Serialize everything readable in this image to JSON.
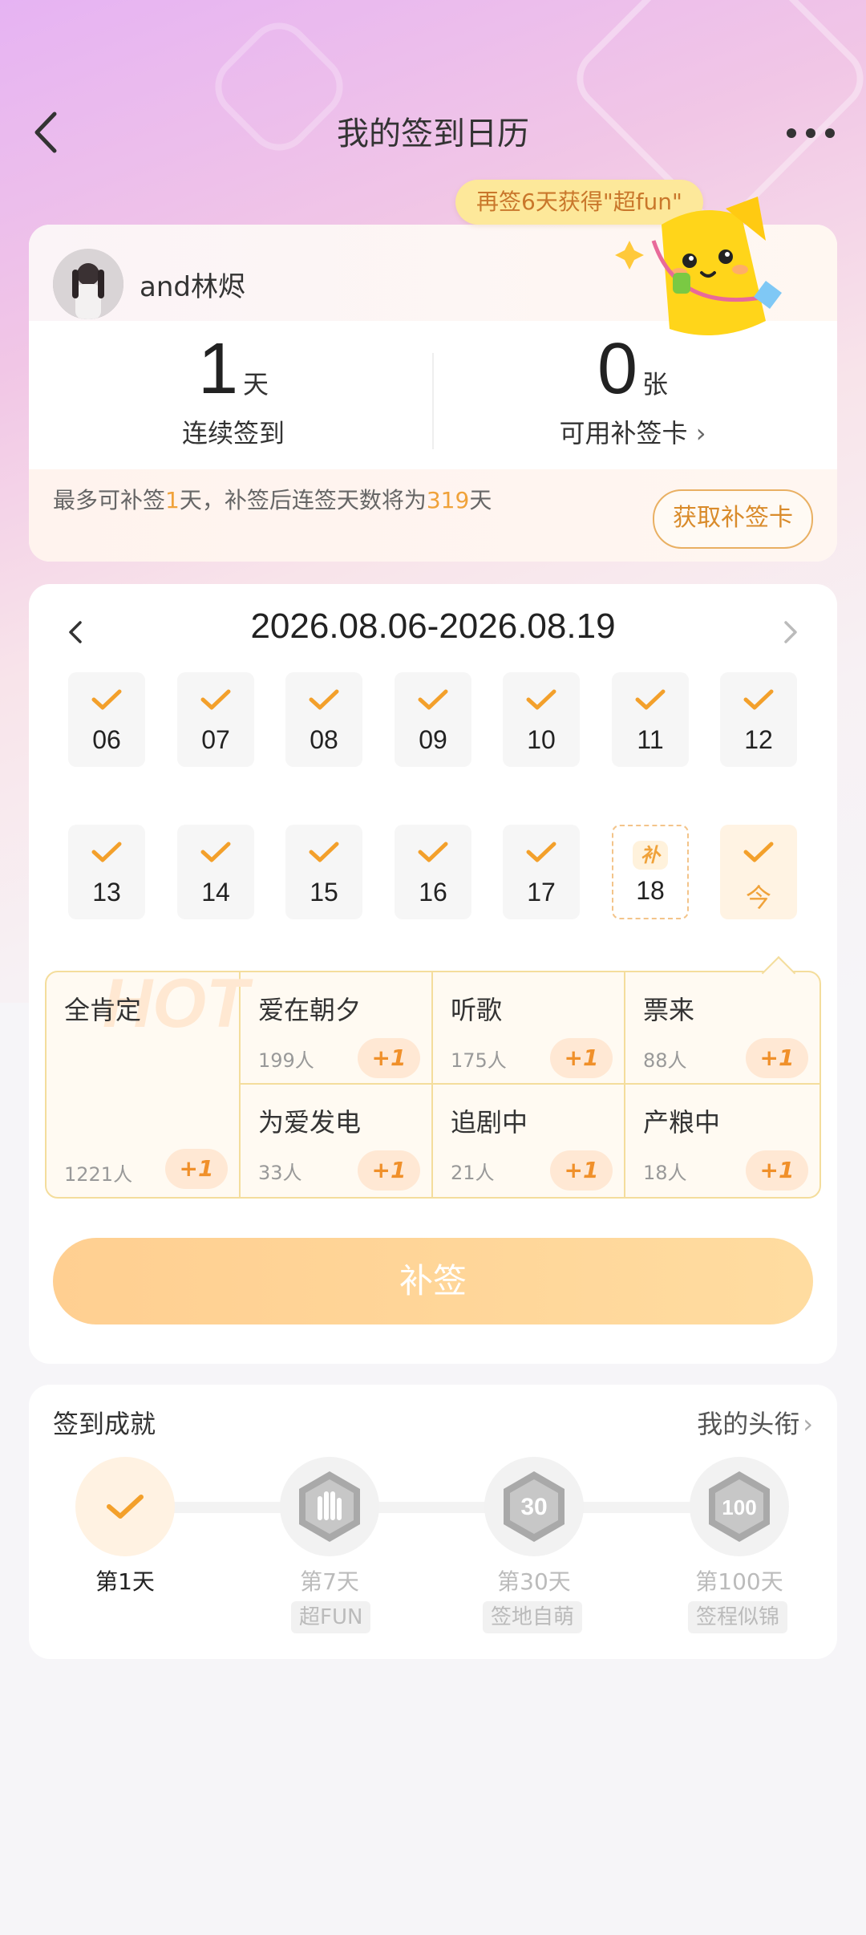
{
  "header": {
    "title": "我的签到日历"
  },
  "promo": {
    "bubble": "再签6天获得\"超fun\""
  },
  "user": {
    "name": "and林烬"
  },
  "stats": {
    "streak_num": "1",
    "streak_unit": "天",
    "streak_label": "连续签到",
    "cards_num": "0",
    "cards_unit": "张",
    "cards_label": "可用补签卡",
    "cards_chevron": "›"
  },
  "makeup": {
    "text_a": "最多可补签",
    "days": "1",
    "text_b": "天，补签后连签天数将为",
    "total": "319",
    "text_c": "天",
    "button": "获取补签卡"
  },
  "calendar": {
    "range": "2026.08.06-2026.08.19",
    "row1": [
      "06",
      "07",
      "08",
      "09",
      "10",
      "11",
      "12"
    ],
    "row2": [
      "13",
      "14",
      "15",
      "16",
      "17"
    ],
    "makeup_day": {
      "tag": "补",
      "num": "18"
    },
    "today": "今"
  },
  "tags": {
    "hot": {
      "name": "全肯定",
      "count": "1221人",
      "plus": "+1",
      "watermark": "HOT"
    },
    "items": [
      {
        "name": "爱在朝夕",
        "count": "199人",
        "plus": "+1"
      },
      {
        "name": "听歌",
        "count": "175人",
        "plus": "+1"
      },
      {
        "name": "票来",
        "count": "88人",
        "plus": "+1"
      },
      {
        "name": "为爱发电",
        "count": "33人",
        "plus": "+1"
      },
      {
        "name": "追剧中",
        "count": "21人",
        "plus": "+1"
      },
      {
        "name": "产粮中",
        "count": "18人",
        "plus": "+1"
      }
    ]
  },
  "bu_button": "补签",
  "achievements": {
    "title": "签到成就",
    "link": "我的头衔",
    "link_chevron": "›",
    "items": [
      {
        "day": "第1天",
        "sub": ""
      },
      {
        "day": "第7天",
        "sub": "超FUN"
      },
      {
        "day": "第30天",
        "sub": "签地自萌"
      },
      {
        "day": "第100天",
        "sub": "签程似锦"
      }
    ]
  },
  "colors": {
    "accent": "#f0a23a",
    "button": "#ffd79a",
    "bubble": "#fde89a"
  }
}
